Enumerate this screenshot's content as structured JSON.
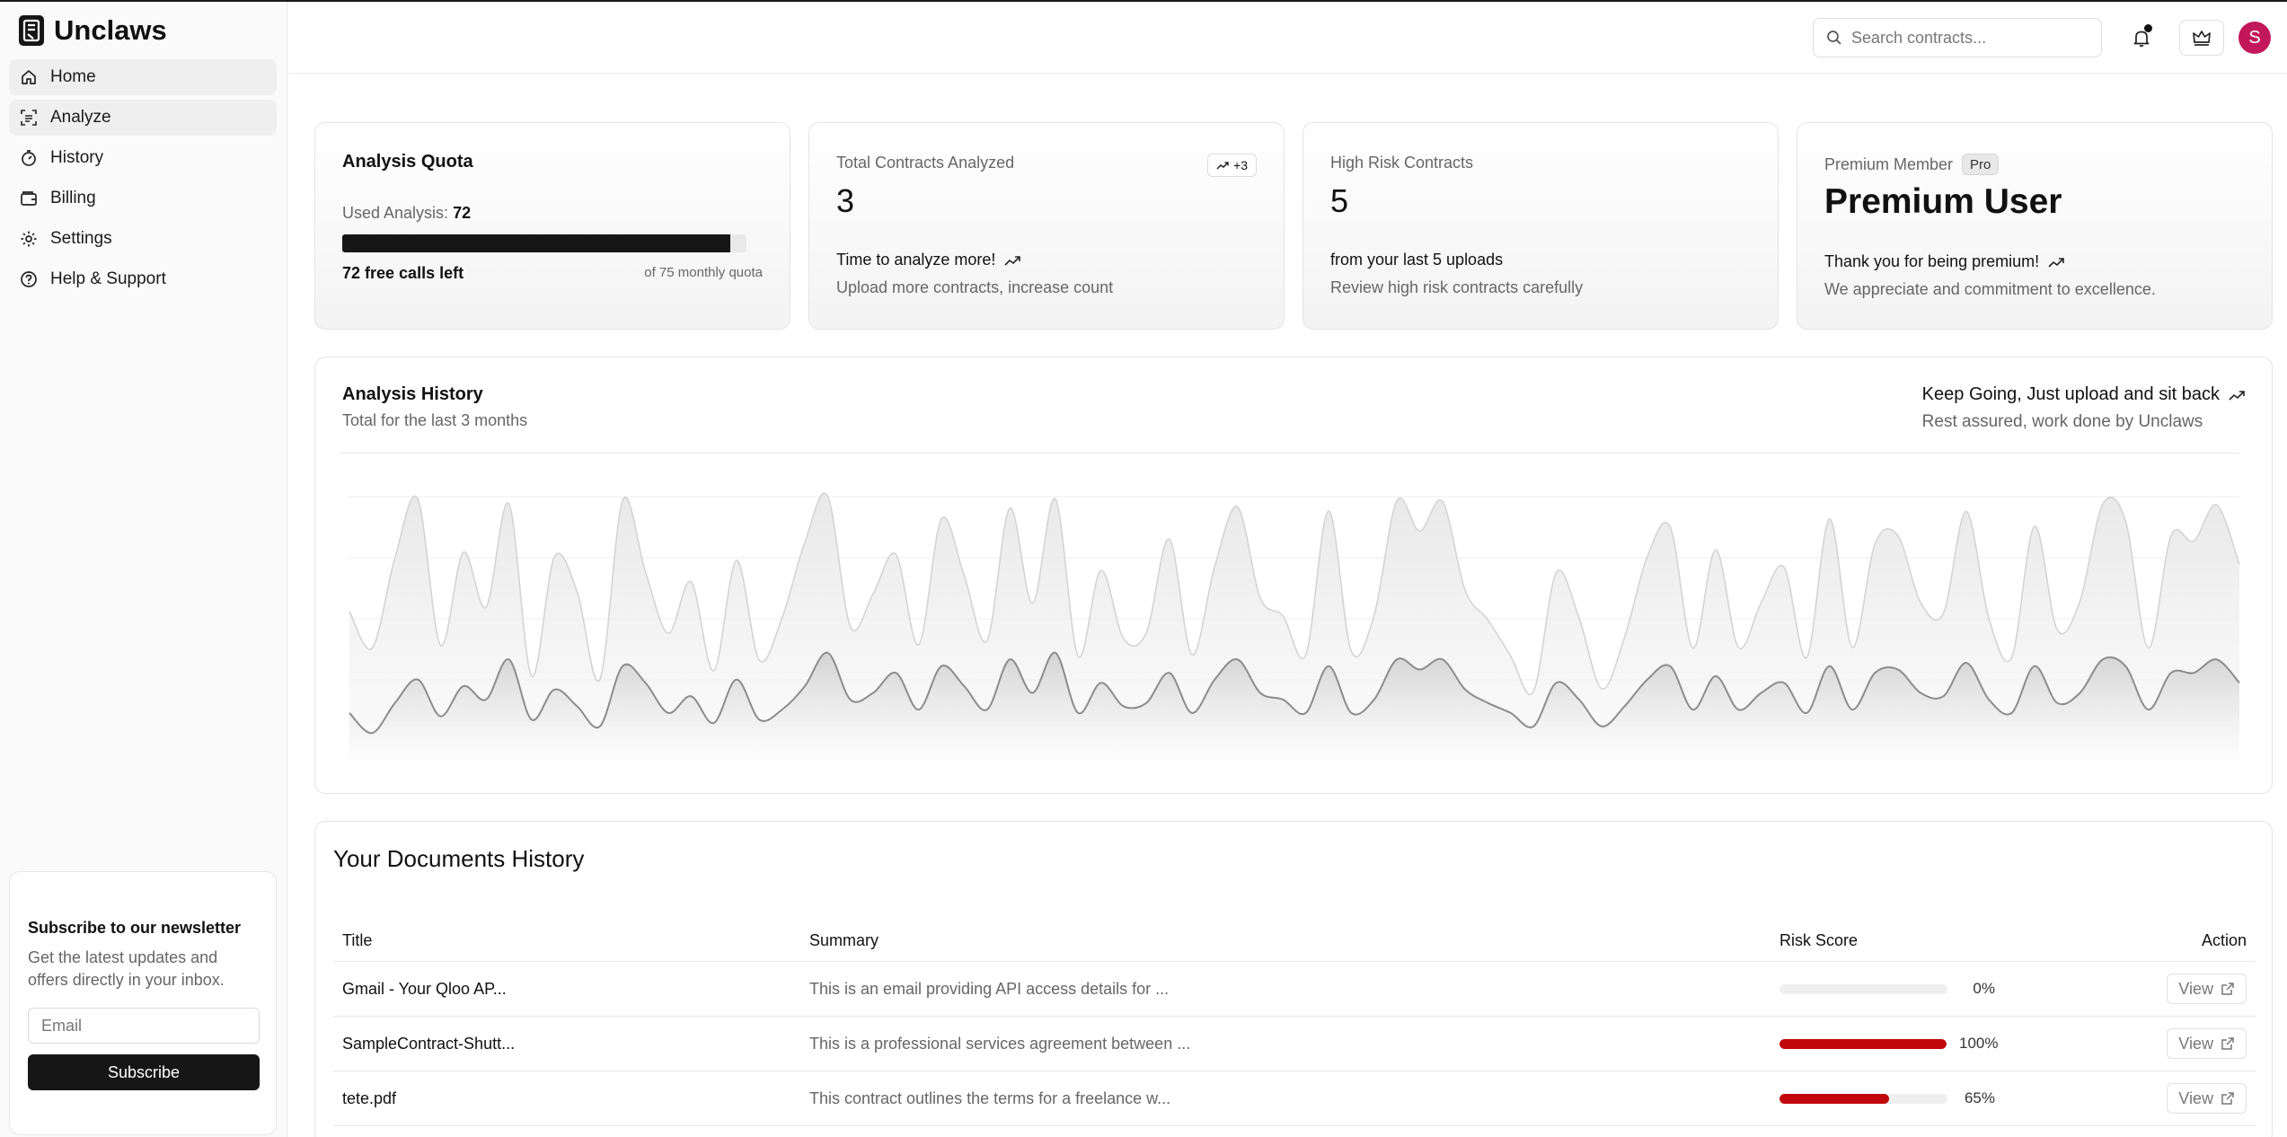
{
  "app": {
    "name": "Unclaws"
  },
  "sidebar": {
    "items": [
      {
        "label": "Home",
        "icon": "home-icon"
      },
      {
        "label": "Analyze",
        "icon": "analyze-icon"
      },
      {
        "label": "History",
        "icon": "timer-icon"
      },
      {
        "label": "Billing",
        "icon": "wallet-icon"
      },
      {
        "label": "Settings",
        "icon": "gear-icon"
      },
      {
        "label": "Help & Support",
        "icon": "help-circle-icon"
      }
    ],
    "newsletter": {
      "title": "Subscribe to our newsletter",
      "text": "Get the latest updates and offers directly in your inbox.",
      "email_placeholder": "Email",
      "button_label": "Subscribe"
    }
  },
  "header": {
    "search_placeholder": "Search contracts...",
    "avatar_initial": "S"
  },
  "cards": {
    "quota": {
      "title": "Analysis Quota",
      "used_label": "Used Analysis:",
      "used_value": "72",
      "used_fraction": 0.96,
      "free_left": "72 free calls left",
      "of_quota": "of 75 monthly quota"
    },
    "total": {
      "label": "Total Contracts Analyzed",
      "value": "3",
      "badge": "+3",
      "line": "Time to analyze more!",
      "sub": "Upload more contracts, increase count"
    },
    "risk": {
      "label": "High Risk Contracts",
      "value": "5",
      "line": "from your last 5 uploads",
      "sub": "Review high risk contracts carefully"
    },
    "premium": {
      "label": "Premium Member",
      "badge": "Pro",
      "value": "Premium User",
      "line": "Thank you for being premium!",
      "sub": "We appreciate and commitment to excellence."
    }
  },
  "analysis_history": {
    "title": "Analysis History",
    "subtitle": "Total for the last 3 months",
    "right_title": "Keep Going, Just upload and sit back",
    "right_sub": "Rest assured, work done by Unclaws"
  },
  "chart_data": {
    "type": "area",
    "series": [
      {
        "values": [
          222,
          167,
          302,
          390,
          171,
          310,
          228,
          383,
          125,
          303,
          251,
          120,
          388,
          281,
          189,
          266,
          133,
          298,
          149,
          212,
          325,
          394,
          199,
          248,
          307,
          172,
          360,
          275,
          178,
          376,
          234,
          390,
          155,
          283,
          181,
          190,
          330,
          157,
          289,
          378,
          242,
          215,
          157,
          372,
          162,
          216,
          387,
          342,
          386,
          253,
          209,
          155,
          102,
          280,
          212,
          106,
          183,
          304,
          348,
          167,
          314,
          168,
          235,
          288,
          153,
          360,
          168,
          323,
          335,
          235,
          219,
          371,
          211,
          153,
          349,
          194,
          237,
          382,
          357,
          167,
          335,
          327,
          381,
          292
        ]
      },
      {
        "values": [
          70,
          40,
          85,
          120,
          65,
          110,
          90,
          150,
          60,
          105,
          80,
          50,
          140,
          115,
          70,
          95,
          55,
          120,
          60,
          75,
          110,
          160,
          90,
          100,
          130,
          75,
          140,
          110,
          75,
          150,
          100,
          160,
          70,
          115,
          80,
          85,
          130,
          70,
          120,
          150,
          100,
          90,
          70,
          140,
          70,
          90,
          150,
          135,
          150,
          105,
          85,
          70,
          50,
          115,
          90,
          50,
          80,
          120,
          140,
          75,
          125,
          75,
          100,
          115,
          70,
          140,
          75,
          130,
          135,
          100,
          95,
          145,
          90,
          70,
          140,
          85,
          100,
          150,
          140,
          75,
          130,
          130,
          150,
          115
        ]
      }
    ],
    "grid": true
  },
  "documents": {
    "title": "Your Documents History",
    "headers": {
      "title": "Title",
      "summary": "Summary",
      "risk": "Risk Score",
      "action": "Action"
    },
    "rows": [
      {
        "title": "Gmail - Your Qloo AP...",
        "summary": "This is an email providing API access details for ...",
        "risk": 0,
        "risk_label": "0%",
        "action": "View"
      },
      {
        "title": "SampleContract-Shutt...",
        "summary": "This is a professional services agreement between ...",
        "risk": 100,
        "risk_label": "100%",
        "action": "View"
      },
      {
        "title": "tete.pdf",
        "summary": "This contract outlines the terms for a freelance w...",
        "risk": 65,
        "risk_label": "65%",
        "action": "View"
      }
    ]
  }
}
